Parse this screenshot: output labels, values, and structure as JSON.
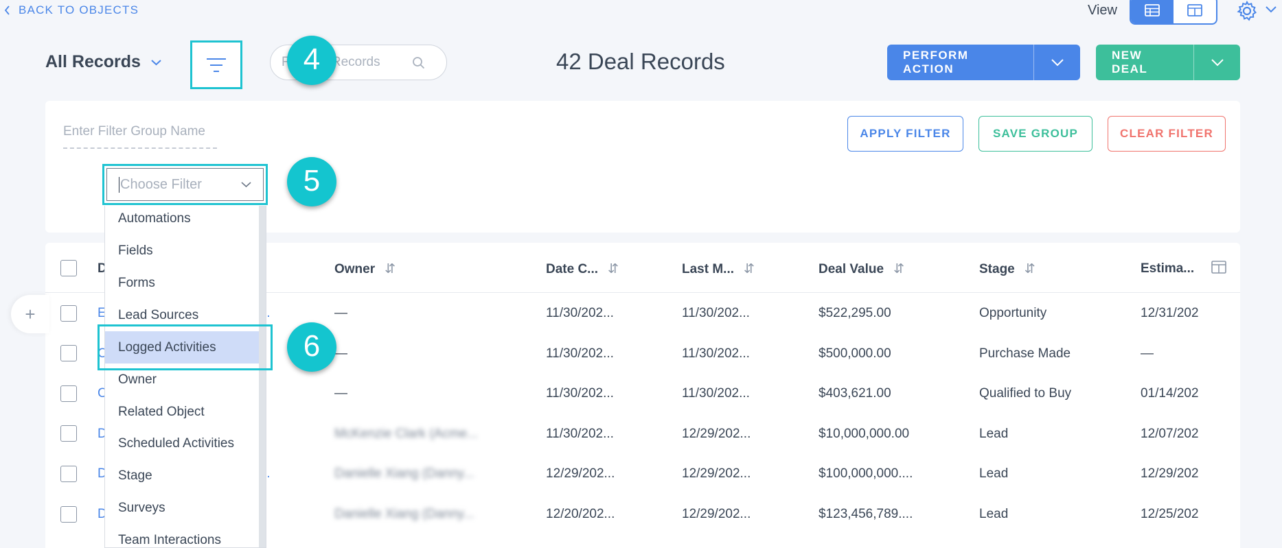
{
  "top_bar": {
    "back_label": "BACK TO OBJECTS",
    "view_label": "View"
  },
  "header": {
    "records_selector": "All Records",
    "search_placeholder": "Filter All Records",
    "records_count": "42 Deal Records",
    "perform_action": "PERFORM ACTION",
    "new_deal": "NEW DEAL"
  },
  "filter_panel": {
    "group_name_placeholder": "Enter Filter Group Name",
    "apply_filter": "APPLY FILTER",
    "save_group": "SAVE GROUP",
    "clear_filter": "CLEAR FILTER",
    "choose_filter_placeholder": "Choose Filter",
    "options": [
      "Automations",
      "Fields",
      "Forms",
      "Lead Sources",
      "Logged Activities",
      "Owner",
      "Related Object",
      "Scheduled Activities",
      "Stage",
      "Surveys",
      "Team Interactions"
    ],
    "selected_option": "Logged Activities"
  },
  "badges": [
    "4",
    "5",
    "6"
  ],
  "table": {
    "columns": [
      "D",
      "Owner",
      "Date C...",
      "Last M...",
      "Deal Value",
      "Stage",
      "Estima..."
    ],
    "rows": [
      {
        "name": "E",
        "name_tail": "..",
        "owner": "—",
        "date_created": "11/30/202...",
        "last_modified": "11/30/202...",
        "deal_value": "$522,295.00",
        "stage": "Opportunity",
        "estimated": "12/31/202"
      },
      {
        "name": "C",
        "name_tail": "",
        "owner": "—",
        "date_created": "11/30/202...",
        "last_modified": "11/30/202...",
        "deal_value": "$500,000.00",
        "stage": "Purchase Made",
        "estimated": "—"
      },
      {
        "name": "C",
        "name_tail": "",
        "owner": "—",
        "date_created": "11/30/202...",
        "last_modified": "11/30/202...",
        "deal_value": "$403,621.00",
        "stage": "Qualified to Buy",
        "estimated": "01/14/202"
      },
      {
        "name": "D",
        "name_tail": "",
        "owner": "McKenzie Clark (Acme...",
        "date_created": "11/30/202...",
        "last_modified": "12/29/202...",
        "deal_value": "$10,000,000.00",
        "stage": "Lead",
        "estimated": "12/07/202"
      },
      {
        "name": "D",
        "name_tail": "..",
        "owner": "Danielle Xiang (Danny...",
        "date_created": "12/29/202...",
        "last_modified": "12/29/202...",
        "deal_value": "$100,000,000....",
        "stage": "Lead",
        "estimated": "12/29/202"
      },
      {
        "name": "D",
        "name_tail": "",
        "owner": "Danielle Xiang (Danny...",
        "date_created": "12/20/202...",
        "last_modified": "12/29/202...",
        "deal_value": "$123,456,789....",
        "stage": "Lead",
        "estimated": "12/25/202"
      }
    ]
  },
  "colors": {
    "accent_blue": "#4a86e8",
    "accent_green": "#3dbf9b",
    "accent_red": "#f0736d",
    "highlight_teal": "#1ec3d1",
    "selected_row": "#cfdcf8"
  }
}
